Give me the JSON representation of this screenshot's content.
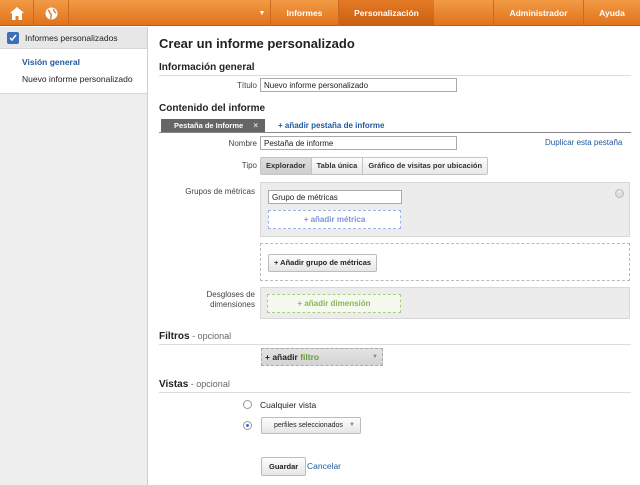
{
  "topbar": {
    "nav": [
      "Informes",
      "Personalización",
      "Administrador",
      "Ayuda"
    ],
    "active": "Personalización",
    "accent": "#e8832d"
  },
  "sidebar": {
    "section_title": "Informes personalizados",
    "items": [
      "Visión general",
      "Nuevo informe personalizado"
    ],
    "selected": "Visión general"
  },
  "page": {
    "title": "Crear un informe personalizado",
    "general_heading": "Información general",
    "title_label": "Título",
    "title_value": "Nuevo informe personalizado",
    "content_heading": "Contenido del informe",
    "tab_label": "Pestaña de Informe",
    "tab_close": "×",
    "add_tab": "+ añadir pestaña de informe",
    "name_label": "Nombre",
    "name_value": "Pestaña de informe",
    "duplicate": "Duplicar esta pestaña",
    "type_label": "Tipo",
    "types": [
      "Explorador",
      "Tabla única",
      "Gráfico de visitas por ubicación"
    ],
    "selected_type": "Explorador",
    "metric_groups_label": "Grupos de métricas",
    "metric_group_value": "Grupo de métricas",
    "add_metric": "+ añadir métrica",
    "add_metric_group": "+ Añadir grupo de métricas",
    "dimensions_label_1": "Desgloses de",
    "dimensions_label_2": "dimensiones",
    "add_dimension": "+ añadir dimensión",
    "filters_heading": "Filtros",
    "filters_optional": " - opcional",
    "add_filter_prefix": "+ añadir ",
    "add_filter_word": "filtro",
    "views_heading": "Vistas",
    "views_optional": " - opcional",
    "any_view": "Cualquier vista",
    "selected_profiles": "perfiles seleccionados",
    "save": "Guardar",
    "cancel": "Cancelar"
  }
}
